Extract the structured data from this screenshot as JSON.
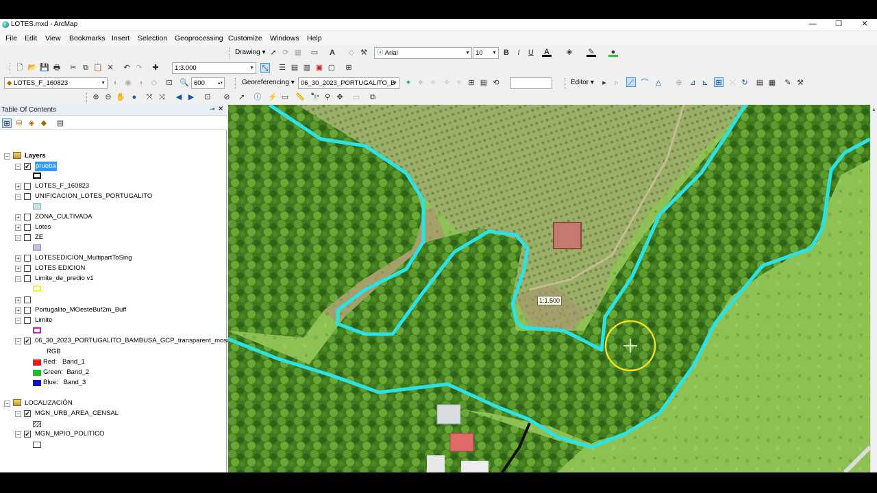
{
  "window": {
    "title": "LOTES.mxd - ArcMap",
    "controls": {
      "minimize": "—",
      "restore": "❐",
      "close": "✕"
    }
  },
  "menu": [
    "File",
    "Edit",
    "View",
    "Bookmarks",
    "Insert",
    "Selection",
    "Geoprocessing",
    "Customize",
    "Windows",
    "Help"
  ],
  "toolbars": {
    "drawing_label": "Drawing",
    "font_name": "Arial",
    "font_size": "10",
    "bold": "B",
    "italic": "I",
    "underline": "U",
    "scale": "1:3.000",
    "layer_select": "LOTES_F_160823",
    "zoom_value": "600",
    "georeferencing_label": "Georeferencing",
    "georef_layer": "06_30_2023_PORTUGALITO_B",
    "editor_label": "Editor"
  },
  "toc": {
    "title": "Table Of Contents",
    "pin": "📌",
    "close": "✕",
    "layers_group": "Layers",
    "items": [
      {
        "label": "prueba",
        "checked": true,
        "expanded": true,
        "selected": true
      },
      {
        "label": "LOTES_F_160823",
        "checked": false,
        "expanded": false
      },
      {
        "label": "UNIFICACION_LOTES_PORTUGALITO",
        "checked": false,
        "expanded": true
      },
      {
        "label": "ZONA_CULTIVADA",
        "checked": false,
        "expanded": false
      },
      {
        "label": "Lotes",
        "checked": false,
        "expanded": false
      },
      {
        "label": "ZE",
        "checked": false,
        "expanded": true
      },
      {
        "label": "LOTESEDICION_MultipartToSing",
        "checked": false,
        "expanded": false
      },
      {
        "label": "LOTES EDICION",
        "checked": false,
        "expanded": false
      },
      {
        "label": "Limite_de_predio v1",
        "checked": false,
        "expanded": true
      },
      {
        "label": "",
        "checked": false,
        "expanded": false
      },
      {
        "label": "Portugalito_MOesteBuf2m_Buff",
        "checked": false,
        "expanded": false
      },
      {
        "label": "Limite",
        "checked": false,
        "expanded": true
      },
      {
        "label": "06_30_2023_PORTUGALITO_BAMBUSA_GCP_transparent_mosai",
        "checked": true,
        "expanded": true
      }
    ],
    "raster": {
      "rgb": "RGB",
      "bands": [
        {
          "label": "Red:",
          "band": "Band_1",
          "color": "#e02020"
        },
        {
          "label": "Green:",
          "band": "Band_2",
          "color": "#20c020"
        },
        {
          "label": "Blue:",
          "band": "Band_3",
          "color": "#1010d0"
        }
      ]
    },
    "group2": "LOCALIZACIÓN",
    "group2_items": [
      {
        "label": "MGN_URB_AREA_CENSAL",
        "checked": true
      },
      {
        "label": "MGN_MPIO_POLITICO",
        "checked": true
      }
    ],
    "symbol_colors": {
      "prueba": "#000000",
      "unificacion": "#bfe6e0",
      "ze": "#c3bfe6",
      "limite_predio": "#f2f23c",
      "limite": "#c020c0"
    }
  },
  "map": {
    "scale_tip": "1:1.500",
    "boundary_color": "#29e3e8",
    "cursor_highlight_color": "#f0e020"
  }
}
